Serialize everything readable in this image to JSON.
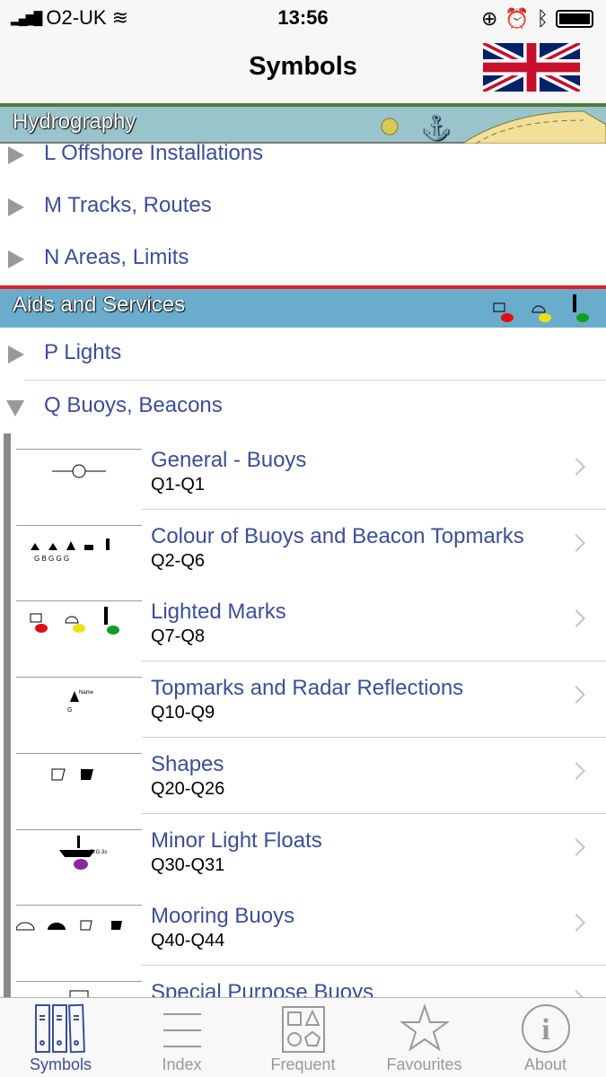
{
  "status": {
    "carrier": "O2-UK",
    "time": "13:56"
  },
  "nav": {
    "title": "Symbols",
    "language_flag": "uk-flag-icon"
  },
  "sections": [
    {
      "title": "Hydrography",
      "color": "#9ac4cc",
      "line": "#4e7a34",
      "items": [
        {
          "label": "L Offshore Installations"
        },
        {
          "label": "M Tracks, Routes"
        },
        {
          "label": "N Areas, Limits"
        }
      ]
    },
    {
      "title": "Aids and Services",
      "color": "#6aaccb",
      "line": "#e0202a",
      "items": [
        {
          "label": "P Lights",
          "expanded": false
        },
        {
          "label": "Q Buoys, Beacons",
          "expanded": true
        }
      ]
    }
  ],
  "subitems": [
    {
      "title": "General - Buoys",
      "code": "Q1-Q1"
    },
    {
      "title": "Colour of Buoys and Beacon Topmarks",
      "code": "Q2-Q6"
    },
    {
      "title": "Lighted Marks",
      "code": "Q7-Q8"
    },
    {
      "title": "Topmarks and Radar Reflections",
      "code": "Q10-Q9"
    },
    {
      "title": "Shapes",
      "code": "Q20-Q26"
    },
    {
      "title": "Minor Light Floats",
      "code": "Q30-Q31"
    },
    {
      "title": "Mooring Buoys",
      "code": "Q40-Q44"
    },
    {
      "title": "Special Purpose Buoys",
      "code": ""
    }
  ],
  "tabs": [
    {
      "label": "Symbols",
      "active": true
    },
    {
      "label": "Index"
    },
    {
      "label": "Frequent"
    },
    {
      "label": "Favourites"
    },
    {
      "label": "About"
    }
  ],
  "colors": {
    "link": "#3b4f95",
    "active_tab": "#3b4f95"
  }
}
